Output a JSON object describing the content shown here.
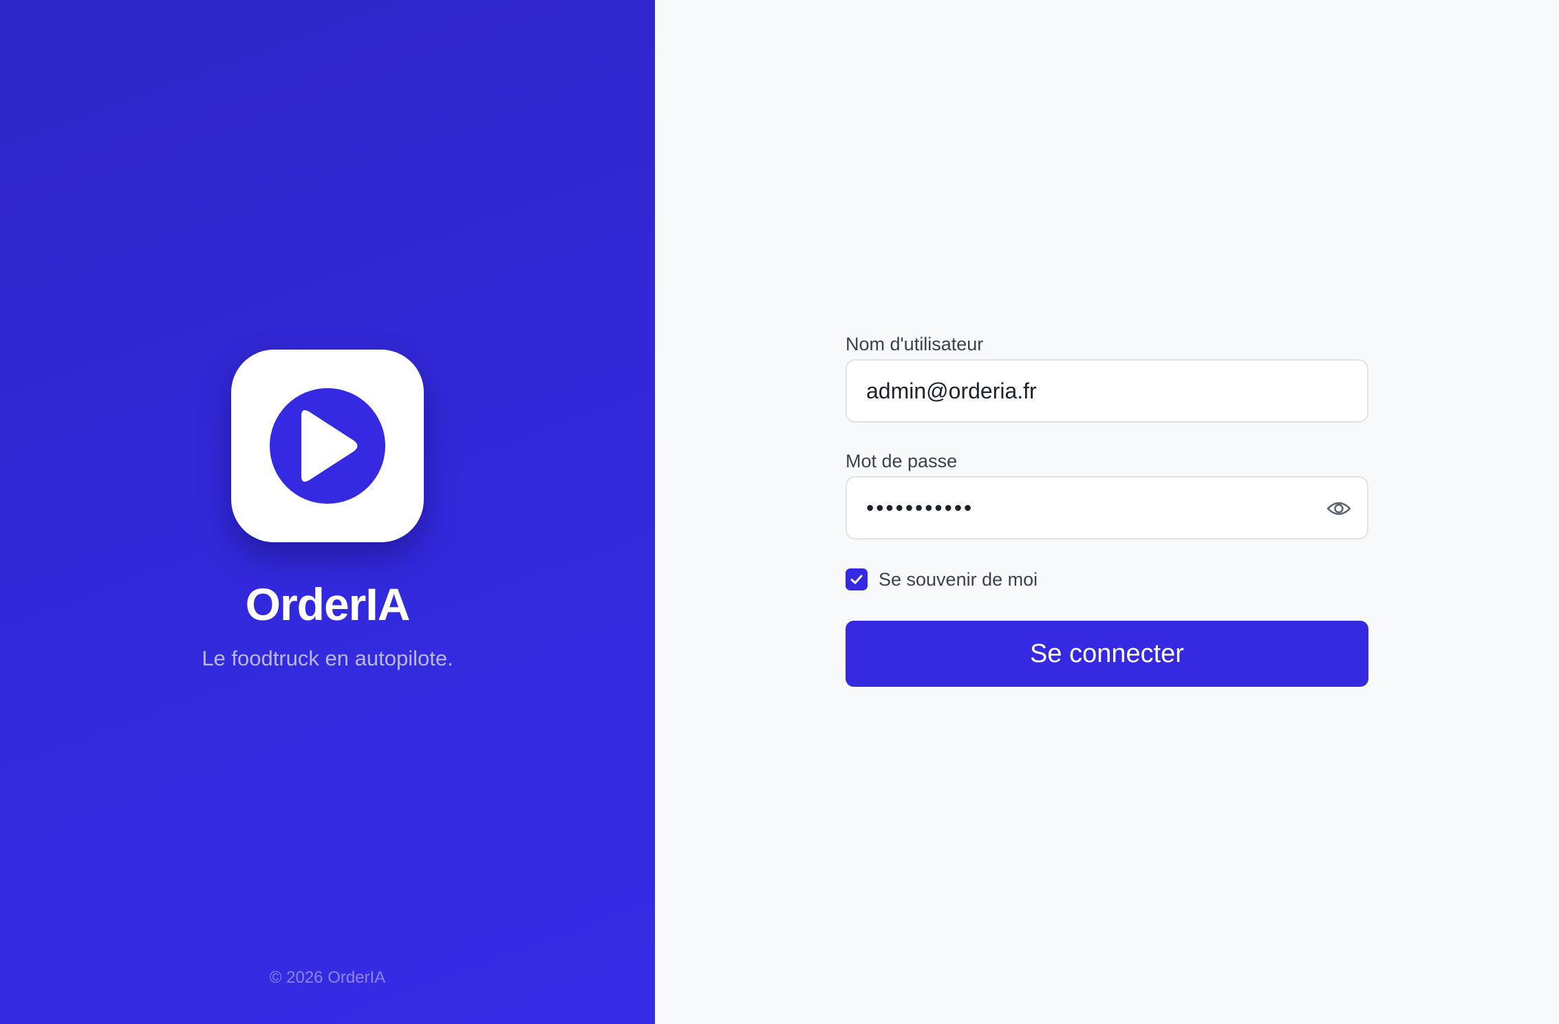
{
  "brand": {
    "name": "OrderIA",
    "tagline": "Le foodtruck en autopilote.",
    "copyright": "© 2026 OrderIA",
    "icon": "play-icon"
  },
  "login_form": {
    "username": {
      "label": "Nom d'utilisateur",
      "value": "admin@orderia.fr"
    },
    "password": {
      "label": "Mot de passe",
      "masked_value": "•••••••••••",
      "toggle_icon": "eye-icon"
    },
    "remember_me": {
      "label": "Se souvenir de moi",
      "checked": true
    },
    "submit_label": "Se connecter"
  },
  "colors": {
    "accent": "#3529e1",
    "brand_panel": "#3028d4",
    "form_background": "#f8f9fb"
  }
}
